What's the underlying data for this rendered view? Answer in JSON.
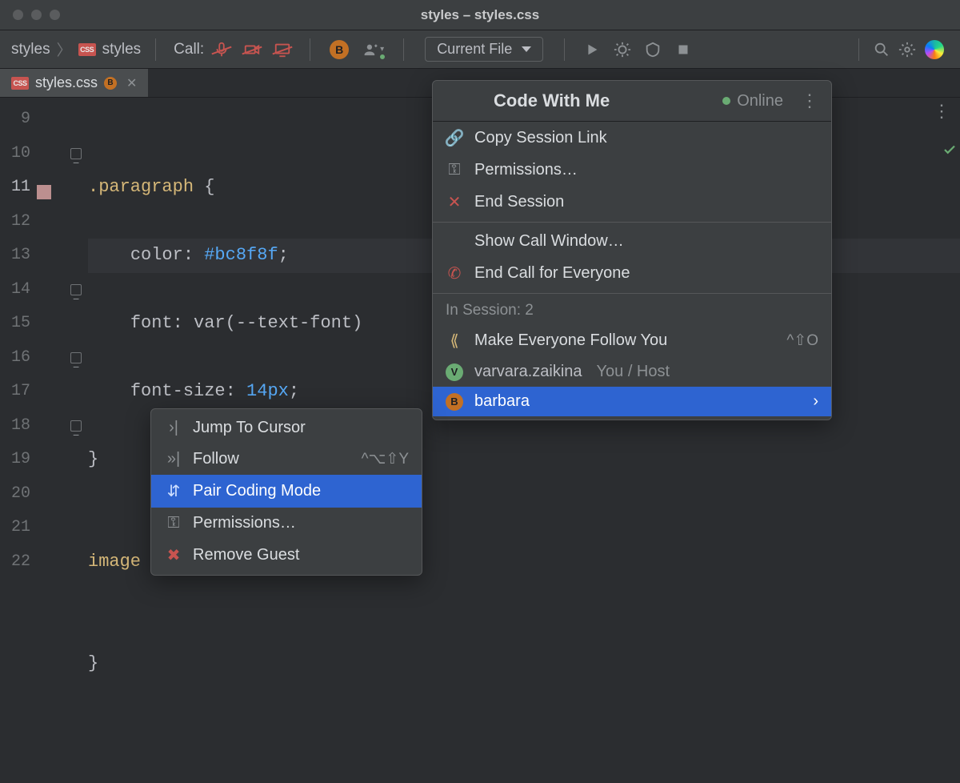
{
  "window": {
    "title": "styles – styles.css"
  },
  "breadcrumbs": {
    "root": "styles",
    "file": "styles"
  },
  "toolbar": {
    "call_label": "Call:",
    "avatar_letter": "B",
    "run_config": "Current File"
  },
  "tab": {
    "filename": "styles.css",
    "badge_letter": "B"
  },
  "gutter_lines": [
    "9",
    "10",
    "11",
    "12",
    "13",
    "14",
    "15",
    "16",
    "17",
    "18",
    "19",
    "20",
    "21",
    "22"
  ],
  "active_line": "11",
  "code": {
    "l10_sel": ".paragraph",
    "l10_brace": " {",
    "l11_key": "color",
    "l11_val": "#bc8f8f",
    "l12_key": "font",
    "l12_val": "var(--text-font)",
    "l13_key": "font-size",
    "l13_num": "14px",
    "l14_brace": "}",
    "l16_sel": "image",
    "l16_brace": " {",
    "l18_brace": "}"
  },
  "cwm": {
    "title": "Code With Me",
    "online": "Online",
    "copy_link": "Copy Session Link",
    "permissions": "Permissions…",
    "end_session": "End Session",
    "show_call": "Show Call Window…",
    "end_call": "End Call for Everyone",
    "in_session_label": "In Session:",
    "in_session_count": "2",
    "follow_you": "Make Everyone Follow You",
    "follow_you_shortcut": "^⇧O",
    "participants": [
      {
        "avatar": "V",
        "name": "varvara.zaikina",
        "suffix": "You / Host",
        "color": "green",
        "highlight": false
      },
      {
        "avatar": "B",
        "name": "barbara",
        "suffix": "",
        "color": "orange",
        "highlight": true
      }
    ]
  },
  "submenu": {
    "jump": "Jump To Cursor",
    "follow": "Follow",
    "follow_shortcut": "^⌥⇧Y",
    "pair": "Pair Coding Mode",
    "permissions": "Permissions…",
    "remove": "Remove Guest"
  },
  "colors": {
    "accent": "#2e64d1",
    "swatch": "#bc8f8f"
  }
}
